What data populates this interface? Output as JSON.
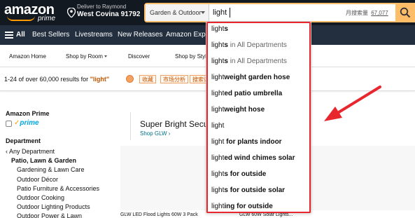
{
  "header": {
    "logo_text": "amazon",
    "logo_sub": "prime",
    "deliver_line1": "Deliver to Raymond",
    "deliver_line2": "West Covina 91792",
    "search_category": "Garden & Outdoor",
    "search_value": "light",
    "search_volume_label": "月搜索量",
    "search_volume_value": "67,077"
  },
  "nav": {
    "all_label": "All",
    "items": [
      "Best Sellers",
      "Livestreams",
      "New Releases",
      "Amazon Explo"
    ]
  },
  "subnav": {
    "items": [
      "Amazon Home",
      "Shop by Room",
      "Discover",
      "Shop by Styl"
    ]
  },
  "results": {
    "prefix": "1-24 of over 60,000 results for ",
    "query": "\"light\"",
    "ext_buttons": [
      "收藏",
      "市场分析",
      "搜索词"
    ]
  },
  "sidebar": {
    "prime_heading": "Amazon Prime",
    "prime_label": "prime",
    "department_heading": "Department",
    "any_department": "‹ Any Department",
    "category": "Patio, Lawn & Garden",
    "subcategories": [
      "Gardening & Lawn Care",
      "Outdoor Décor",
      "Patio Furniture & Accessories",
      "Outdoor Cooking",
      "Outdoor Lighting Products",
      "Outdoor Power & Lawn"
    ]
  },
  "main": {
    "brand_title": "Super Bright Secu",
    "brand_link": "Shop GLW ›",
    "product1_title": "GLW LED Flood Lights 60W 3 Pack",
    "product2_title": "GLW 60W Solar Lights..."
  },
  "suggestions": [
    {
      "prefix": "light",
      "rest": "s",
      "dept": ""
    },
    {
      "prefix": "light",
      "rest": "s",
      "dept": " in All Departments"
    },
    {
      "prefix": "light",
      "rest": "s",
      "dept": " in All Departments"
    },
    {
      "prefix": "light",
      "rest": "weight garden hose",
      "dept": ""
    },
    {
      "prefix": "light",
      "rest": "ed patio umbrella",
      "dept": ""
    },
    {
      "prefix": "light",
      "rest": "weight hose",
      "dept": ""
    },
    {
      "prefix": "light",
      "rest": "",
      "dept": ""
    },
    {
      "prefix": "light",
      "rest": " for plants indoor",
      "dept": ""
    },
    {
      "prefix": "light",
      "rest": "ed wind chimes solar",
      "dept": ""
    },
    {
      "prefix": "light",
      "rest": "s for outside",
      "dept": ""
    },
    {
      "prefix": "light",
      "rest": "s for outside solar",
      "dept": ""
    },
    {
      "prefix": "light",
      "rest": "ing for outside",
      "dept": ""
    }
  ],
  "colors": {
    "header_bg": "#131921",
    "nav_bg": "#232f3e",
    "accent": "#febd69",
    "annotation_red": "#e8262e"
  }
}
